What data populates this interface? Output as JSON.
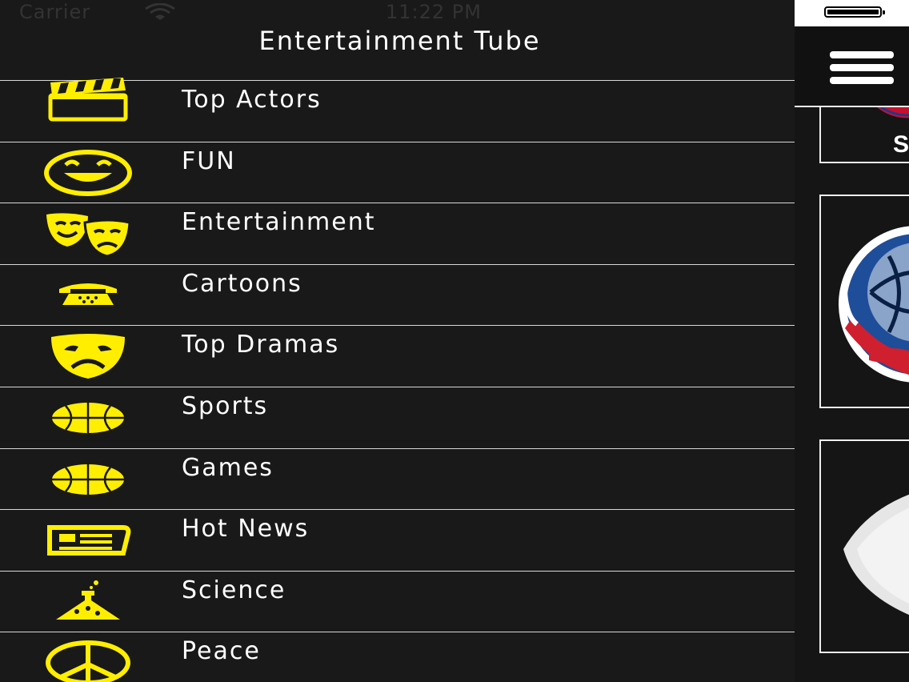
{
  "status_bar": {
    "carrier": "Carrier",
    "time": "11:22 PM"
  },
  "drawer": {
    "title": "Entertainment Tube",
    "items": [
      {
        "label": "Top Actors",
        "icon": "clapperboard-icon"
      },
      {
        "label": "FUN",
        "icon": "smiley-icon"
      },
      {
        "label": "Entertainment",
        "icon": "theater-masks-icon"
      },
      {
        "label": "Cartoons",
        "icon": "telephone-icon"
      },
      {
        "label": "Top Dramas",
        "icon": "sad-mask-icon"
      },
      {
        "label": "Sports",
        "icon": "basketball-icon"
      },
      {
        "label": "Games",
        "icon": "basketball-icon"
      },
      {
        "label": "Hot News",
        "icon": "newspaper-icon"
      },
      {
        "label": "Science",
        "icon": "flask-icon"
      },
      {
        "label": "Peace",
        "icon": "peace-icon"
      }
    ]
  },
  "main": {
    "menu_button": "hamburger-menu-icon",
    "peek_text": "S"
  },
  "colors": {
    "icon_yellow": "#ffee00",
    "background": "#191919",
    "divider": "#d8d8d8",
    "text": "#ffffff"
  }
}
